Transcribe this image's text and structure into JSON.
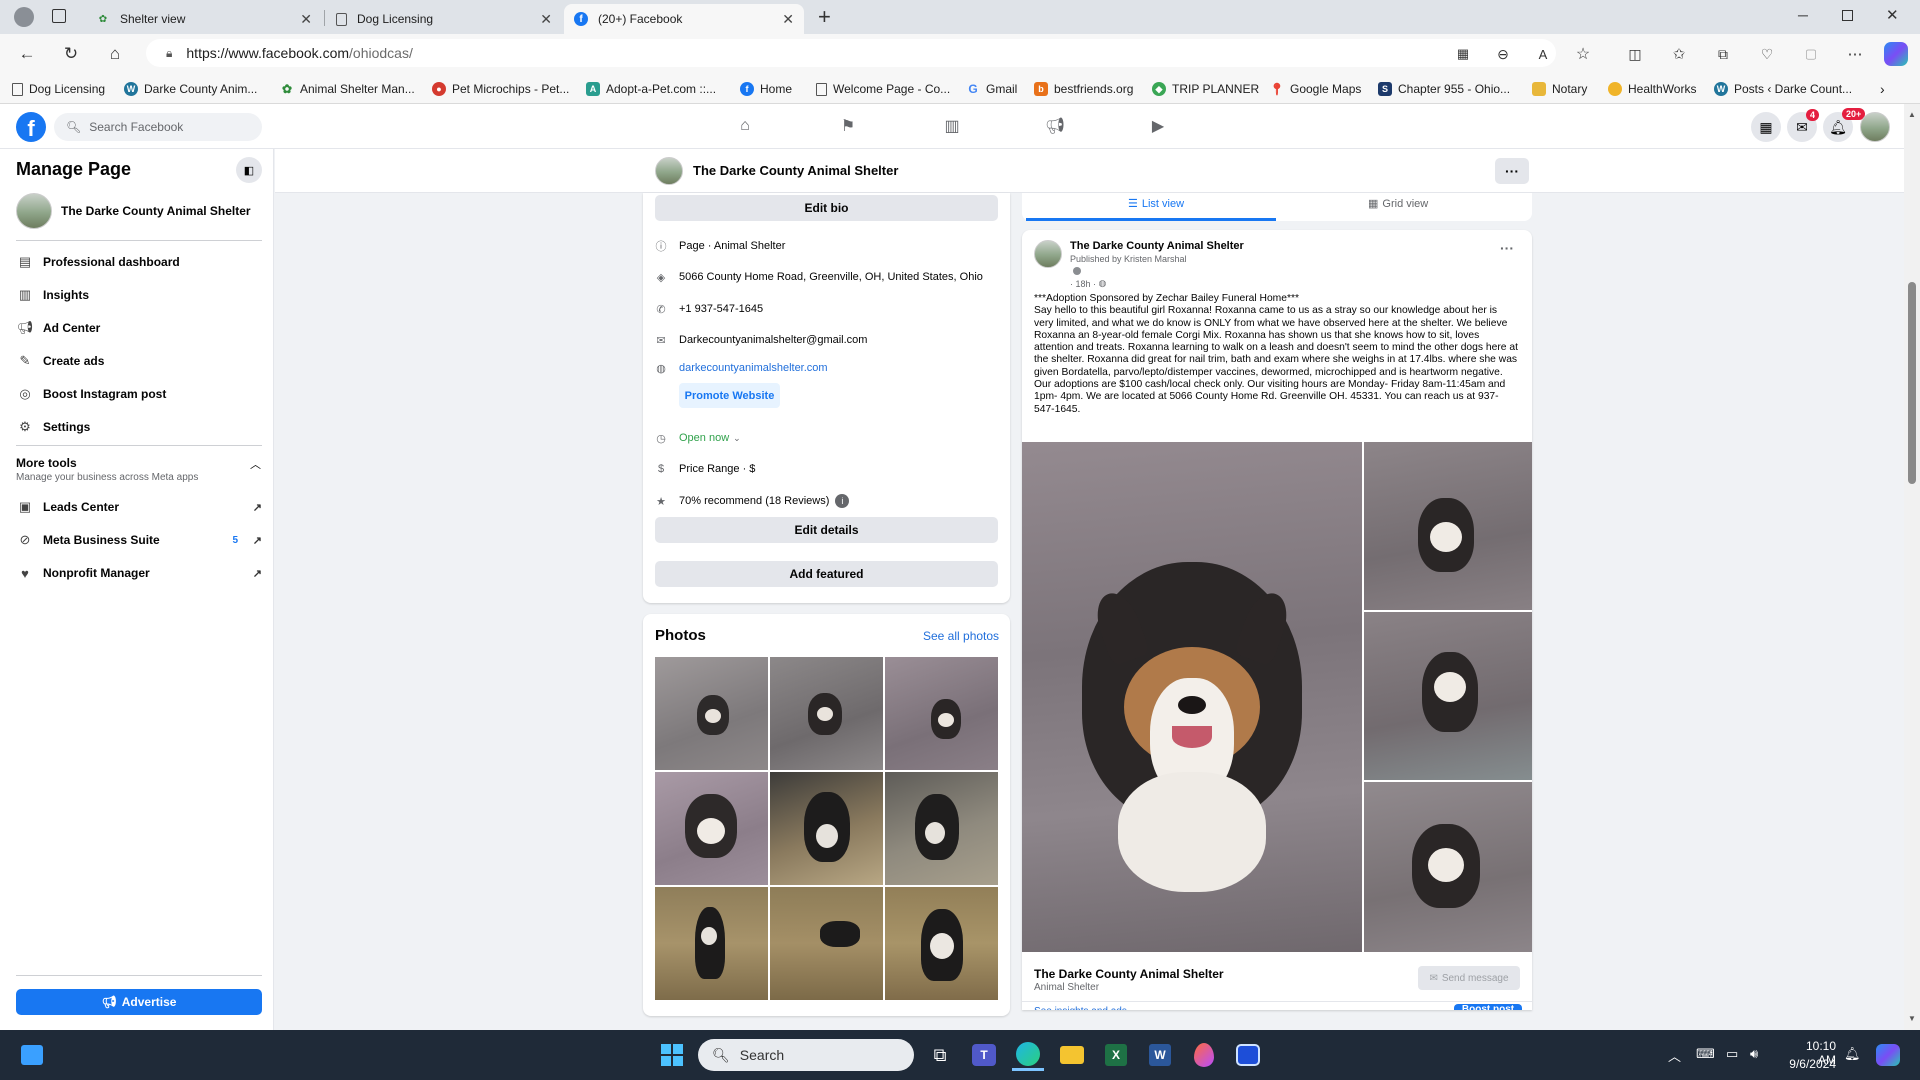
{
  "browser": {
    "tabs": [
      {
        "label": "Shelter view",
        "icon": "paw-icon"
      },
      {
        "label": "Dog Licensing",
        "icon": "page-icon"
      },
      {
        "label": "(20+) Facebook",
        "icon": "facebook-icon"
      }
    ],
    "url_host": "https://www.facebook.com",
    "url_path": "/ohiodcas/",
    "favorites": [
      "Dog Licensing",
      "Darke County Anim...",
      "Animal Shelter Man...",
      "Pet Microchips - Pet...",
      "Adopt-a-Pet.com ::...",
      "Home",
      "Welcome Page - Co...",
      "Gmail",
      "bestfriends.org",
      "TRIP PLANNER",
      "Google Maps",
      "Chapter 955 - Ohio...",
      "Notary",
      "HealthWorks",
      "Posts ‹ Darke Count..."
    ]
  },
  "header": {
    "search_placeholder": "Search Facebook",
    "messenger_badge": "4",
    "notifications_badge": "20+"
  },
  "sidebar": {
    "title": "Manage Page",
    "page_name": "The Darke County Animal Shelter",
    "items": [
      {
        "label": "Professional dashboard"
      },
      {
        "label": "Insights"
      },
      {
        "label": "Ad Center"
      },
      {
        "label": "Create ads"
      },
      {
        "label": "Boost Instagram post"
      },
      {
        "label": "Settings"
      }
    ],
    "more_tools_title": "More tools",
    "more_tools_subtitle": "Manage your business across Meta apps",
    "tools": [
      {
        "label": "Leads Center"
      },
      {
        "label": "Meta Business Suite",
        "count": "5"
      },
      {
        "label": "Nonprofit Manager"
      }
    ],
    "advertise_label": "Advertise"
  },
  "page_bar": {
    "name": "The Darke County Animal Shelter"
  },
  "intro": {
    "edit_bio": "Edit bio",
    "category": "Page · Animal Shelter",
    "address": "5066 County Home Road, Greenville, OH, United States, Ohio",
    "phone": "+1 937-547-1645",
    "email": "Darkecountyanimalshelter@gmail.com",
    "website": "darkecountyanimalshelter.com",
    "promote_website": "Promote Website",
    "hours": "Open now",
    "price_range": "Price Range · $",
    "recommend": "70% recommend (18 Reviews)",
    "edit_details": "Edit details",
    "add_featured": "Add featured"
  },
  "photos": {
    "title": "Photos",
    "see_all": "See all photos"
  },
  "view_tabs": {
    "list": "List view",
    "grid": "Grid view"
  },
  "post": {
    "author": "The Darke County Animal Shelter",
    "published_by": "Published by Kristen Marshal",
    "time": "18h",
    "text": "***Adoption Sponsored by Zechar Bailey Funeral Home***\nSay hello to this beautiful girl Roxanna! Roxanna came to us as a stray so our knowledge about her is very limited, and what we do know is ONLY from what we have observed here at the shelter. We believe Roxanna an 8-year-old female Corgi Mix.  Roxanna has shown us that she knows how to sit, loves attention and treats. Roxanna learning to walk on a leash and doesn't seem to mind the other dogs here at the shelter. Roxanna did great for nail trim, bath and exam where she weighs in at 17.4lbs. where she was given Bordatella, parvo/lepto/distemper vaccines, dewormed, microchipped and is heartworm negative. Our adoptions are $100 cash/local check only. Our visiting hours are Monday- Friday 8am-11:45am and 1pm- 4pm. We are located at 5066 County Home Rd. Greenville OH. 45331. You can reach us at 937-547-1645.",
    "footer_name": "The Darke County Animal Shelter",
    "footer_category": "Animal Shelter",
    "send_message": "Send message",
    "see_insights": "See insights and ads",
    "boost_post": "Boost post"
  },
  "taskbar": {
    "search_placeholder": "Search",
    "time": "10:10 AM",
    "date": "9/6/2024"
  },
  "colors": {
    "facebook_blue": "#1877f2",
    "page_bg": "#f0f2f5",
    "open_green": "#31a24c"
  }
}
